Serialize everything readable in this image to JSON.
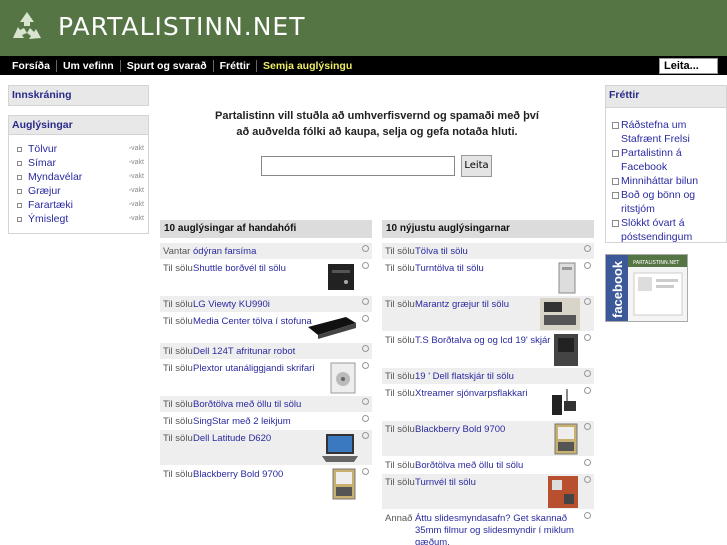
{
  "header": {
    "site_title": "PARTALISTINN.NET",
    "logo_icon": "recycle-icon"
  },
  "nav": {
    "items": [
      "Forsíða",
      "Um vefinn",
      "Spurt og svarað",
      "Fréttir",
      "Semja auglýsingu"
    ],
    "search_value": "Leita..."
  },
  "sidebar": {
    "login_title": "Innskráning",
    "ads_title": "Auglýsingar",
    "categories": [
      {
        "label": "Tölvur",
        "feed": "rss-icon"
      },
      {
        "label": "Símar",
        "feed": "rss-icon"
      },
      {
        "label": "Myndavélar",
        "feed": "rss-icon"
      },
      {
        "label": "Græjur",
        "feed": "rss-icon"
      },
      {
        "label": "Farartæki",
        "feed": "rss-icon"
      },
      {
        "label": "Ýmislegt",
        "feed": "rss-icon"
      }
    ]
  },
  "intro": {
    "line1": "Partalistinn vill stuðla að umhverfisvernd og spamaði með því",
    "line2": "að auðvelda fólki að kaupa, selja og gefa notaða hluti."
  },
  "search": {
    "value": "",
    "button": "Leita"
  },
  "random": {
    "title": "10 auglýsingar af handahófi",
    "rows": [
      {
        "type": "Vantar",
        "title": "ódýran farsíma"
      },
      {
        "type": "Til sölu",
        "title": "Shuttle borðvél til sölu"
      },
      {
        "type": "Til sölu",
        "title": "LG Viewty KU990i"
      },
      {
        "type": "Til sölu",
        "title": "Media Center tölva í stofuna"
      },
      {
        "type": "Til sölu",
        "title": "Dell 124T afritunar robot"
      },
      {
        "type": "Til sölu",
        "title": "Plextor utanáliggjandi skrifari"
      },
      {
        "type": "Til sölu",
        "title": "Borðtölva með öllu til sölu"
      },
      {
        "type": "Til sölu",
        "title": "SingStar með 2 leikjum"
      },
      {
        "type": "Til sölu",
        "title": "Dell Latitude D620"
      },
      {
        "type": "Til sölu",
        "title": "Blackberry Bold 9700"
      }
    ]
  },
  "newest": {
    "title": "10 nýjustu auglýsingarnar",
    "rows": [
      {
        "type": "Til sölu",
        "title": "Tölva til sölu"
      },
      {
        "type": "Til sölu",
        "title": "Turntölva til sölu"
      },
      {
        "type": "Til sölu",
        "title": "Marantz græjur til sölu"
      },
      {
        "type": "Til sölu",
        "title": "T.S Borðtalva og og lcd 19' skjár"
      },
      {
        "type": "Til sölu",
        "title": "19 ' Dell flatskjár til sölu"
      },
      {
        "type": "Til sölu",
        "title": "Xtreamer sjónvarpsflakkari"
      },
      {
        "type": "Til sölu",
        "title": "Blackberry Bold 9700"
      },
      {
        "type": "Til sölu",
        "title": "Borðtölva með öllu til sölu"
      },
      {
        "type": "Til sölu",
        "title": "Turnvél til sölu"
      },
      {
        "type": "Annað",
        "title": "Áttu slidesmyndasafn? Get skannað 35mm filmur og slidesmyndir í miklum gæðum."
      }
    ]
  },
  "news": {
    "title": "Fréttir",
    "items": [
      "Ráðstefna um Stafrænt Frelsi",
      "Partalistinn á Facebook",
      "Minniháttar bilun",
      "Boð og bönn og ritstjóm",
      "Slökkt óvart á póstsendingum"
    ]
  },
  "facebook": {
    "label": "facebook",
    "site": "PARTALISTINN.NET"
  },
  "colors": {
    "header": "#557545",
    "nav": "#000000",
    "link": "#2a2aa0",
    "nav_highlight": "#eded6a"
  }
}
